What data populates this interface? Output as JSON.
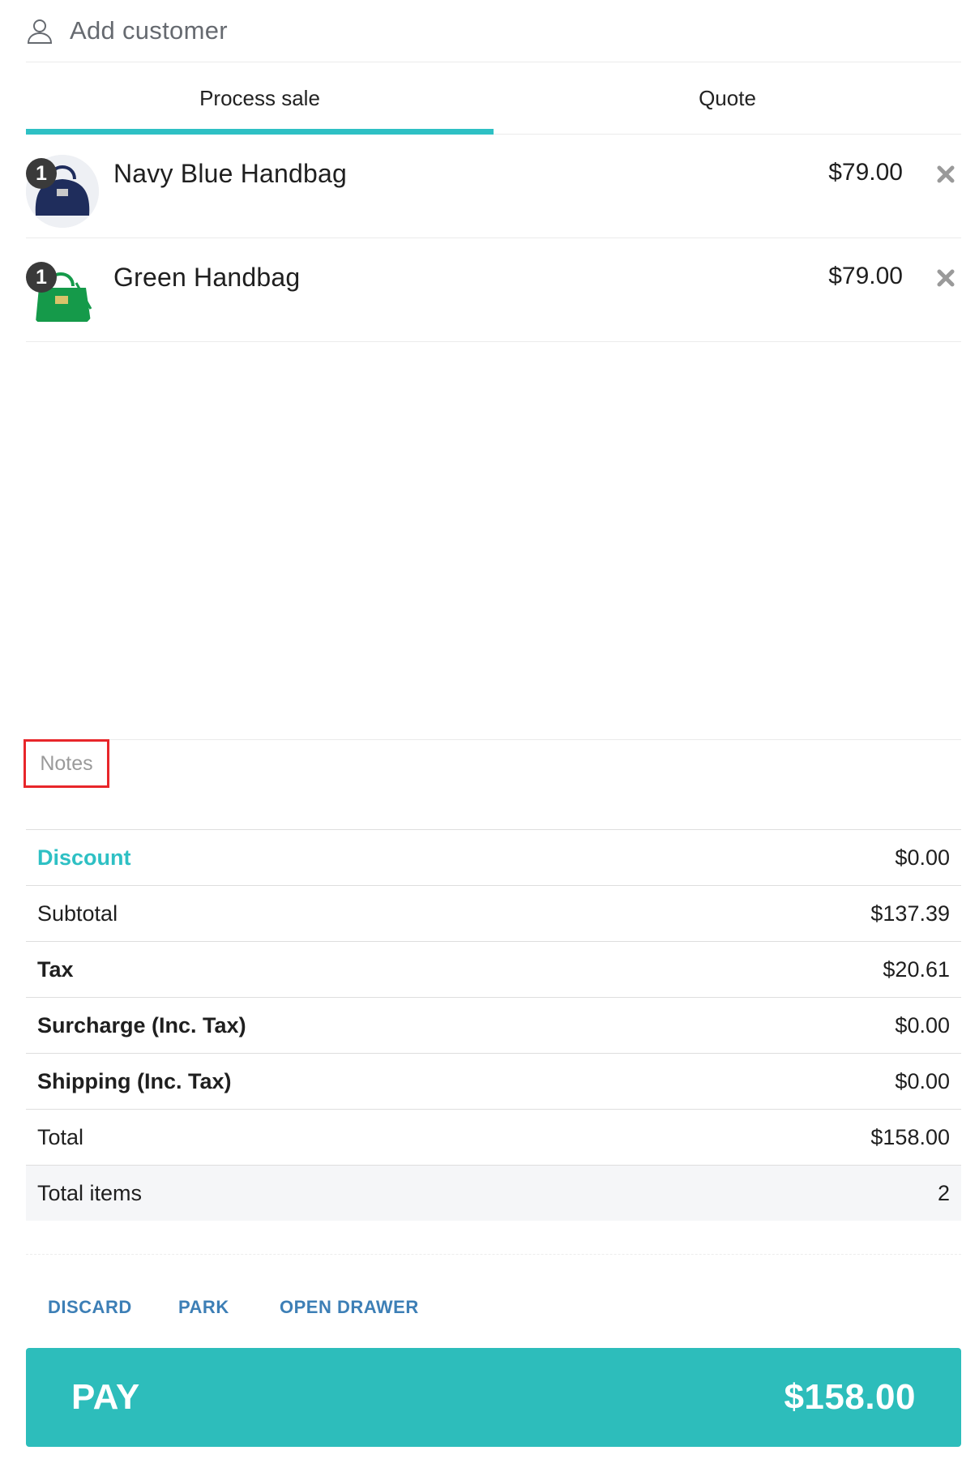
{
  "customer": {
    "label": "Add customer",
    "icon": "user-icon"
  },
  "tabs": [
    {
      "label": "Process sale",
      "active": true
    },
    {
      "label": "Quote",
      "active": false
    }
  ],
  "line_items": [
    {
      "qty": "1",
      "name": "Navy Blue Handbag",
      "price": "$79.00",
      "thumb_color": "#1f2d5c"
    },
    {
      "qty": "1",
      "name": "Green Handbag",
      "price": "$79.00",
      "thumb_color": "#159a4a"
    }
  ],
  "notes": {
    "placeholder": "Notes",
    "value": ""
  },
  "totals": {
    "discount": {
      "label": "Discount",
      "value": "$0.00"
    },
    "subtotal": {
      "label": "Subtotal",
      "value": "$137.39"
    },
    "tax": {
      "label": "Tax",
      "value": "$20.61"
    },
    "surcharge": {
      "label": "Surcharge (Inc. Tax)",
      "value": "$0.00"
    },
    "shipping": {
      "label": "Shipping (Inc. Tax)",
      "value": "$0.00"
    },
    "total": {
      "label": "Total",
      "value": "$158.00"
    },
    "total_items": {
      "label": "Total items",
      "value": "2"
    }
  },
  "actions": {
    "discard": "DISCARD",
    "park": "PARK",
    "open_drawer": "OPEN DRAWER"
  },
  "pay": {
    "label": "PAY",
    "amount": "$158.00"
  },
  "colors": {
    "accent": "#2ec0c4",
    "pay_bg": "#2dbdbb",
    "link": "#3d7fb6",
    "highlight_border": "#e8262a"
  }
}
